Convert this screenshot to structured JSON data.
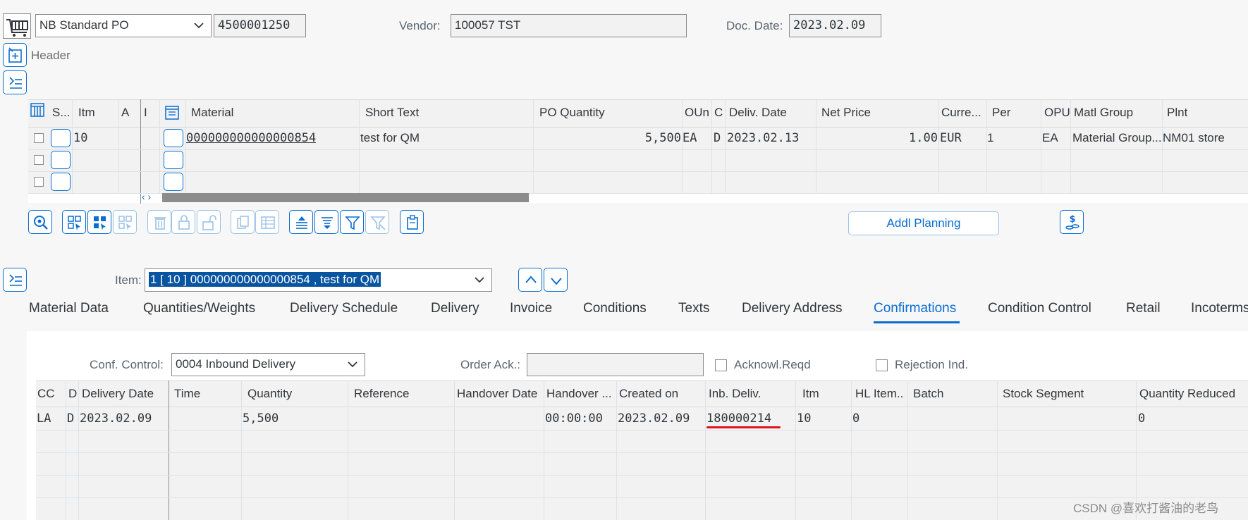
{
  "header": {
    "doc_type": "NB Standard PO",
    "po_number": "4500001250",
    "vendor_label": "Vendor:",
    "vendor_value": "100057 TST",
    "doc_date_label": "Doc. Date:",
    "doc_date_value": "2023.02.09",
    "section_label": "Header"
  },
  "item_overview": {
    "columns": [
      "S...",
      "Itm",
      "A",
      "I",
      "Material",
      "Short Text",
      "PO Quantity",
      "OUn",
      "C",
      "Deliv. Date",
      "Net Price",
      "Curre...",
      "Per",
      "OPU",
      "Matl Group",
      "Plnt"
    ],
    "row": {
      "itm": "10",
      "material": "000000000000000854",
      "short_text": "test for QM",
      "po_quantity": "5,500",
      "oun": "EA",
      "c": "D",
      "deliv_date": "2023.02.13",
      "net_price": "1.00",
      "currency": "EUR",
      "per": "1",
      "opu": "EA",
      "matl_group": "Material Group...",
      "plnt": "NM01 store"
    },
    "scroll_arrows": "‹ ›",
    "addl_planning": "Addl Planning"
  },
  "item_detail": {
    "item_label": "Item:",
    "item_value": "1 [ 10 ] 000000000000000854 , test for QM",
    "tabs": [
      "Material Data",
      "Quantities/Weights",
      "Delivery Schedule",
      "Delivery",
      "Invoice",
      "Conditions",
      "Texts",
      "Delivery Address",
      "Confirmations",
      "Condition Control",
      "Retail",
      "Incoterms"
    ],
    "active_tab": "Confirmations"
  },
  "confirmations": {
    "conf_control_label": "Conf. Control:",
    "conf_control_value": "0004 Inbound Delivery",
    "order_ack_label": "Order Ack.:",
    "order_ack_value": "",
    "acknowl_reqd": "Acknowl.Reqd",
    "rejection_ind": "Rejection Ind.",
    "columns": [
      "CC",
      "D",
      "Delivery Date",
      "Time",
      "Quantity",
      "Reference",
      "Handover Date",
      "Handover ...",
      "Created on",
      "Inb. Deliv.",
      "Itm",
      "HL Item...",
      "Batch",
      "Stock Segment",
      "Quantity Reduced"
    ],
    "row": {
      "cc": "LA",
      "d": "D",
      "delivery_date": "2023.02.09",
      "quantity": "5,500",
      "handover_time": "00:00:00",
      "created_on": "2023.02.09",
      "inb_deliv": "180000214",
      "itm": "10",
      "hl_item": "0",
      "quantity_reduced": "0"
    }
  },
  "watermark": "CSDN @喜欢打酱油的老鸟",
  "colors": {
    "accent": "#0a6ed1",
    "highlight_underline": "#e0141e",
    "selection_bg": "#0854a0"
  }
}
